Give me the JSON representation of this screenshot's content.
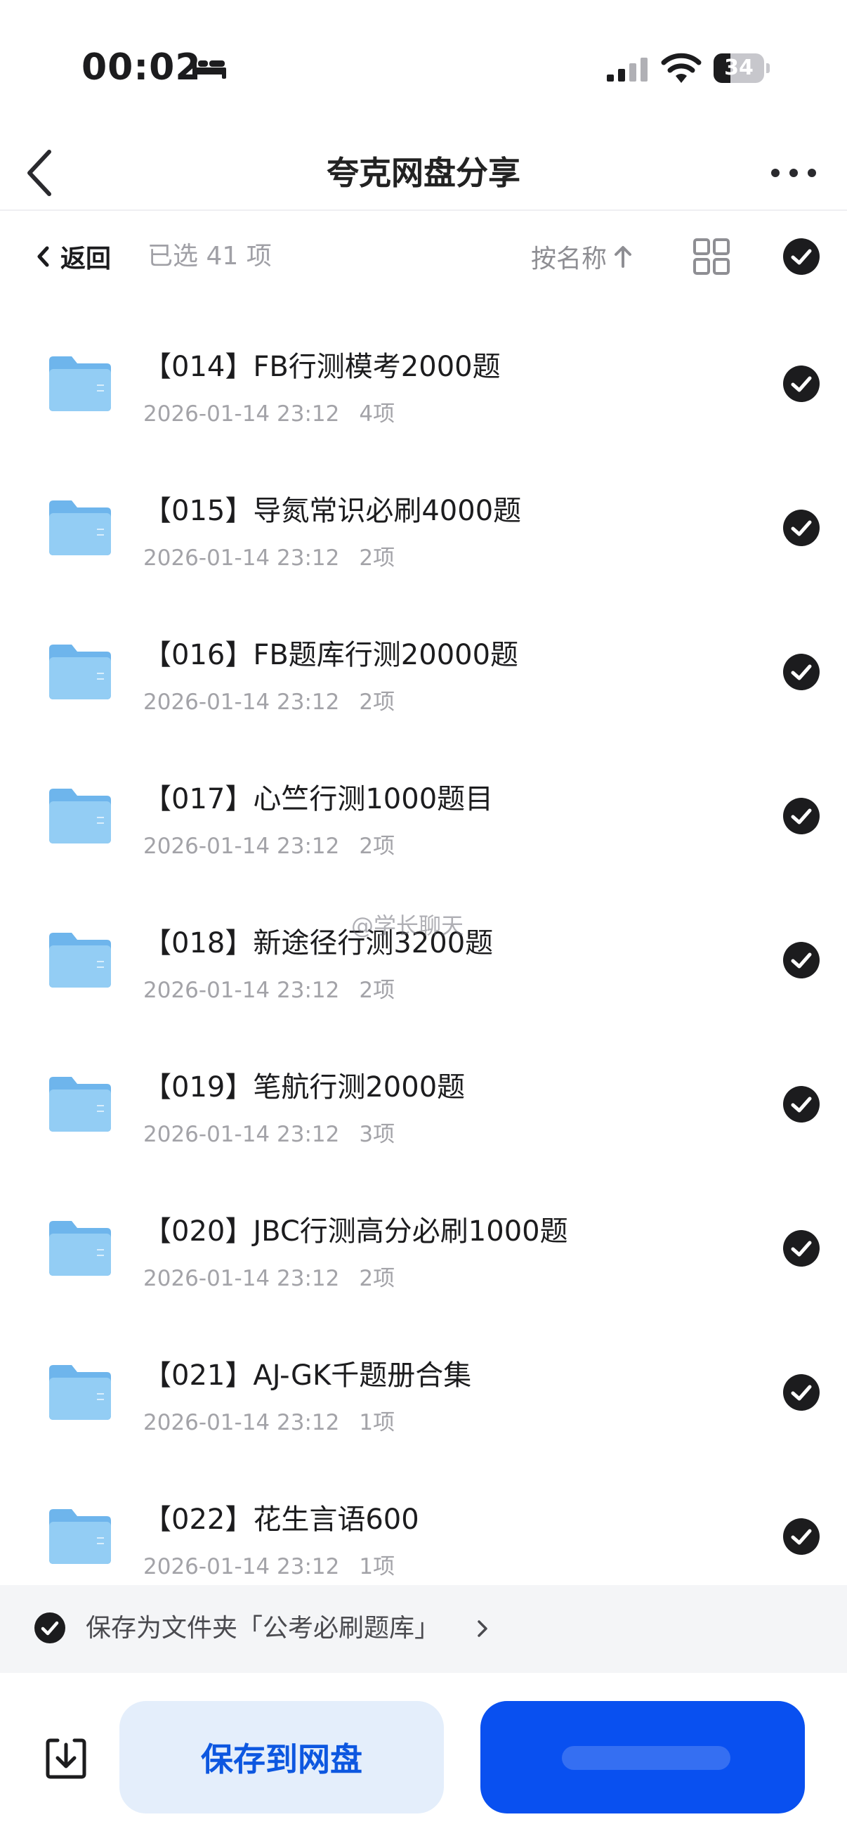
{
  "status_bar": {
    "time": "00:02",
    "battery": "34",
    "battery_level": 0.34,
    "icons": [
      "bed-icon",
      "signal-icon",
      "wifi-icon",
      "battery-icon"
    ]
  },
  "nav": {
    "title": "夸克网盘分享",
    "icons": [
      "chevron-left-icon",
      "more-icon"
    ]
  },
  "toolbar": {
    "back_label": "返回",
    "selected_label": "已选 41 项",
    "sort_label": "按名称",
    "icons": [
      "arrow-up-icon",
      "grid-icon",
      "check-circle-icon"
    ]
  },
  "files": [
    {
      "name": "【014】FB行测模考2000题",
      "date": "2026-01-14 23:12",
      "count": "4项"
    },
    {
      "name": "【015】导氮常识必刷4000题",
      "date": "2026-01-14 23:12",
      "count": "2项"
    },
    {
      "name": "【016】FB题库行测20000题",
      "date": "2026-01-14 23:12",
      "count": "2项"
    },
    {
      "name": "【017】心竺行测1000题目",
      "date": "2026-01-14 23:12",
      "count": "2项"
    },
    {
      "name": "【018】新途径行测3200题",
      "date": "2026-01-14 23:12",
      "count": "2项"
    },
    {
      "name": "【019】笔航行测2000题",
      "date": "2026-01-14 23:12",
      "count": "3项"
    },
    {
      "name": "【020】JBC行测高分必刷1000题",
      "date": "2026-01-14 23:12",
      "count": "2项"
    },
    {
      "name": "【021】AJ-GK千题册合集",
      "date": "2026-01-14 23:12",
      "count": "1项"
    },
    {
      "name": "【022】花生言语600",
      "date": "2026-01-14 23:12",
      "count": "1项"
    }
  ],
  "save_folder": {
    "text": "保存为文件夹「公考必刷题库」"
  },
  "bottom": {
    "save_label": "保存到网盘",
    "icons": [
      "download-icon"
    ]
  },
  "watermark": "@学长聊天",
  "colors": {
    "primary_blue": "#0950f0",
    "light_blue": "#e4eefb",
    "folder_blue": "#8cc8f2"
  }
}
